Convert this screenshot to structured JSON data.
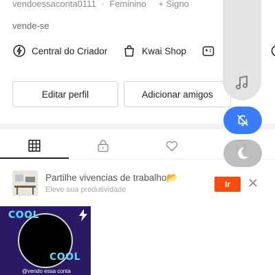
{
  "profile": {
    "username": "vendoessaconta0111",
    "separator": "·",
    "gender": "Feminino",
    "sign_label": "+ Signo",
    "status": "vende-se"
  },
  "quick_links": [
    {
      "label": "Central do Criador",
      "icon": "lightning-circle-icon"
    },
    {
      "label": "Kwai Shop",
      "icon": "shopping-bag-icon"
    },
    {
      "label": "",
      "icon": "gamepad-icon"
    }
  ],
  "buttons": {
    "edit_profile": "Editar perfil",
    "add_friends": "Adicionar amigos"
  },
  "tabs": [
    {
      "name": "grid",
      "icon": "grid-icon",
      "active": true
    },
    {
      "name": "private",
      "icon": "lock-icon",
      "active": false
    },
    {
      "name": "likes",
      "icon": "heart-icon",
      "active": false
    },
    {
      "name": "collections",
      "icon": "bookmark-icon",
      "active": false
    }
  ],
  "promo": {
    "title": "Partilhe vivencias de trabalho📂",
    "subtitle": "Eleve sua produtividade",
    "action_label": "Ir"
  },
  "video": {
    "overlay_text_top": "COOL",
    "overlay_text_bottom": "COOL",
    "caption": "@vendo essa conta"
  },
  "floating_controls": {
    "music_icon": "music-note-icon",
    "mute_icon": "bell-off-icon",
    "theme_icon": "moon-icon"
  },
  "colors": {
    "accent_orange": "#fa4a0c",
    "accent_blue": "#3a7dfb",
    "text_dark": "#222222",
    "text_muted": "#8a8a8a"
  }
}
